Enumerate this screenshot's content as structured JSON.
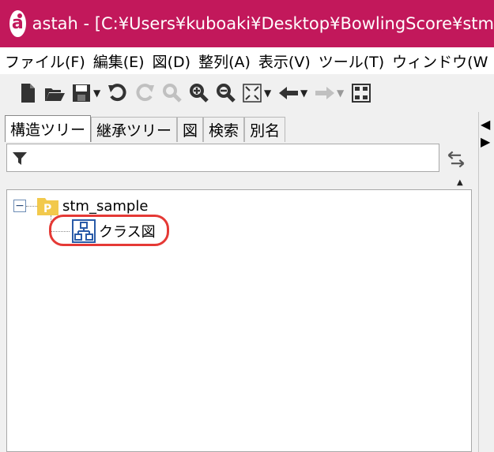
{
  "window": {
    "title": "astah - [C:¥Users¥kuboaki¥Desktop¥BowlingScore¥stm",
    "logo_letter": "a",
    "accent_color": "#c2185b"
  },
  "menu": {
    "items": [
      {
        "label": "ファイル(F)"
      },
      {
        "label": "編集(E)"
      },
      {
        "label": "図(D)"
      },
      {
        "label": "整列(A)"
      },
      {
        "label": "表示(V)"
      },
      {
        "label": "ツール(T)"
      },
      {
        "label": "ウィンドウ(W"
      }
    ]
  },
  "toolbar": {
    "icons": [
      "new-file-icon",
      "open-folder-icon",
      "save-icon",
      "undo-icon",
      "redo-icon",
      "zoom-icon",
      "zoom-in-icon",
      "zoom-out-icon",
      "fit-window-icon",
      "back-arrow-icon",
      "forward-arrow-icon",
      "layout-icon"
    ]
  },
  "tabs": [
    {
      "label": "構造ツリー",
      "active": true
    },
    {
      "label": "継承ツリー",
      "active": false
    },
    {
      "label": "図",
      "active": false
    },
    {
      "label": "検索",
      "active": false
    },
    {
      "label": "別名",
      "active": false
    }
  ],
  "filter": {
    "value": "",
    "placeholder": ""
  },
  "tree": {
    "root": {
      "label": "stm_sample",
      "icon": "package-icon",
      "expanded": true,
      "expander_symbol": "−",
      "package_letter": "P"
    },
    "children": [
      {
        "label": "クラス図",
        "icon": "class-diagram-icon",
        "highlighted": true
      }
    ]
  }
}
